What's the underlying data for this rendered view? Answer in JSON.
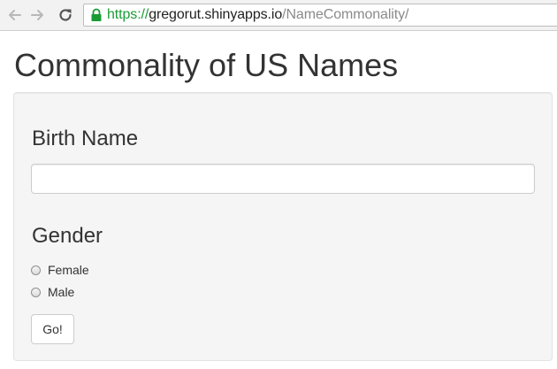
{
  "browser": {
    "url_scheme": "https://",
    "url_host": "gregorut.shinyapps.io",
    "url_path": "/NameCommonality/",
    "icons": {
      "back": "back-arrow-icon",
      "forward": "forward-arrow-icon",
      "reload": "reload-icon",
      "secure": "lock-icon"
    },
    "secure_color": "#1a9c35"
  },
  "page": {
    "title": "Commonality of US Names"
  },
  "form": {
    "birth_name_label": "Birth Name",
    "birth_name_value": "",
    "gender_label": "Gender",
    "gender_options": [
      "Female",
      "Male"
    ],
    "gender_selected": null,
    "submit_label": "Go!"
  }
}
